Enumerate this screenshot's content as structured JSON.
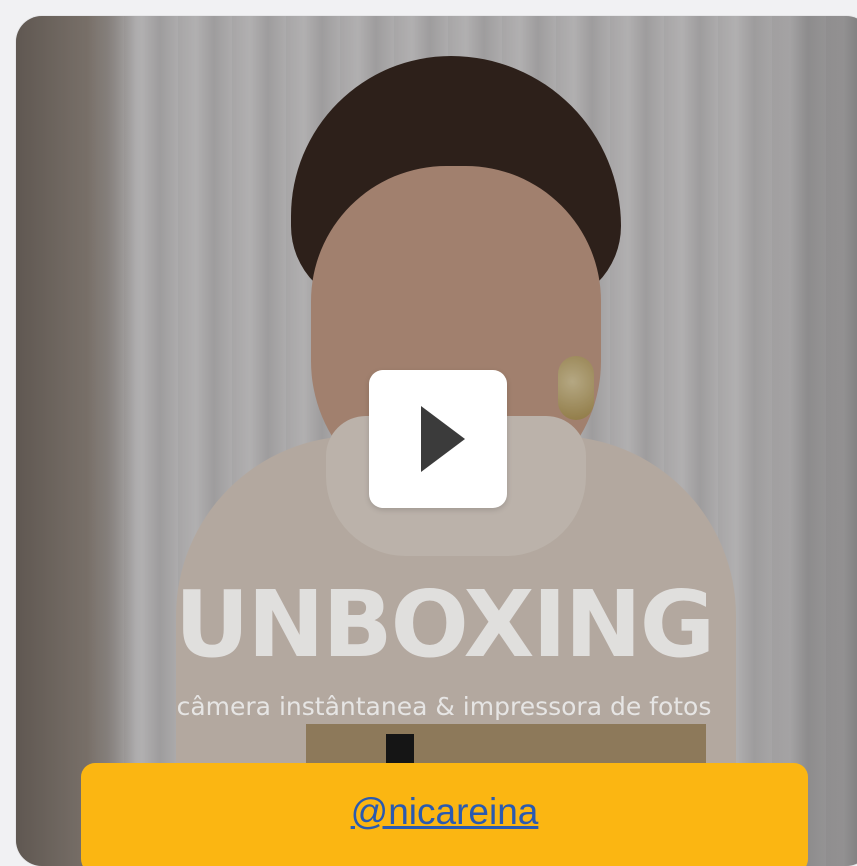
{
  "video": {
    "headline": "UNBOXING",
    "subline": "câmera instântanea & impressora de fotos",
    "play_icon": "play-icon"
  },
  "creator": {
    "handle": "@nicareina"
  },
  "colors": {
    "handle_bar": "#fbb612",
    "link": "#2a5ab0",
    "play_button": "#ffffff"
  }
}
